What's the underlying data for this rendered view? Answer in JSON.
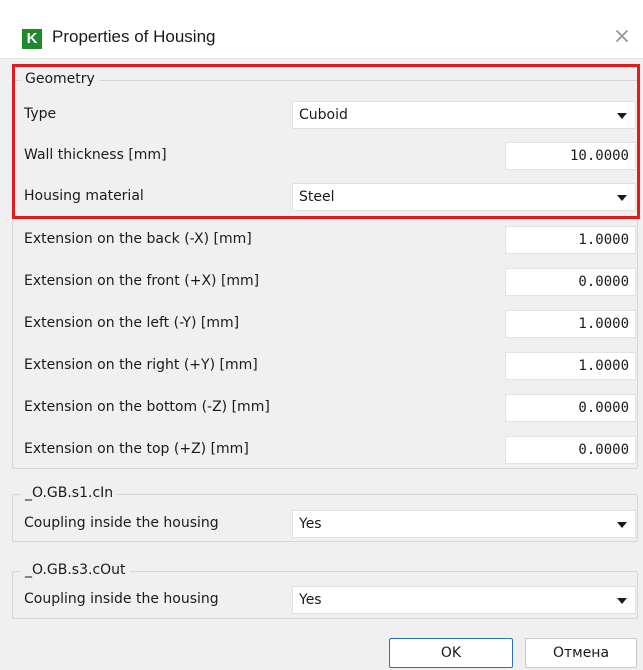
{
  "window": {
    "app_icon_letter": "K",
    "title": "Properties of Housing",
    "close_glyph": "×"
  },
  "colors": {
    "highlight": "#e01c1c",
    "app_icon": "#1e8a2c",
    "ok_border": "#2b6fd6"
  },
  "geometry": {
    "legend": "Geometry",
    "type_label": "Type",
    "type_value": "Cuboid",
    "wall_label": "Wall thickness [mm]",
    "wall_value": "10.0000",
    "material_label": "Housing material",
    "material_value": "Steel"
  },
  "extensions": [
    {
      "label": "Extension on the back (-X) [mm]",
      "value": "1.0000"
    },
    {
      "label": "Extension on the front (+X) [mm]",
      "value": "0.0000"
    },
    {
      "label": "Extension on the left (-Y) [mm]",
      "value": "1.0000"
    },
    {
      "label": "Extension on the right (+Y) [mm]",
      "value": "1.0000"
    },
    {
      "label": "Extension on the bottom (-Z) [mm]",
      "value": "0.0000"
    },
    {
      "label": "Extension on the top (+Z) [mm]",
      "value": "0.0000"
    }
  ],
  "coupling_in": {
    "legend": "_O.GB.s1.cIn",
    "label": "Coupling inside the housing",
    "value": "Yes"
  },
  "coupling_out": {
    "legend": "_O.GB.s3.cOut",
    "label": "Coupling inside the housing",
    "value": "Yes"
  },
  "buttons": {
    "ok": "OK",
    "cancel": "Отмена"
  }
}
